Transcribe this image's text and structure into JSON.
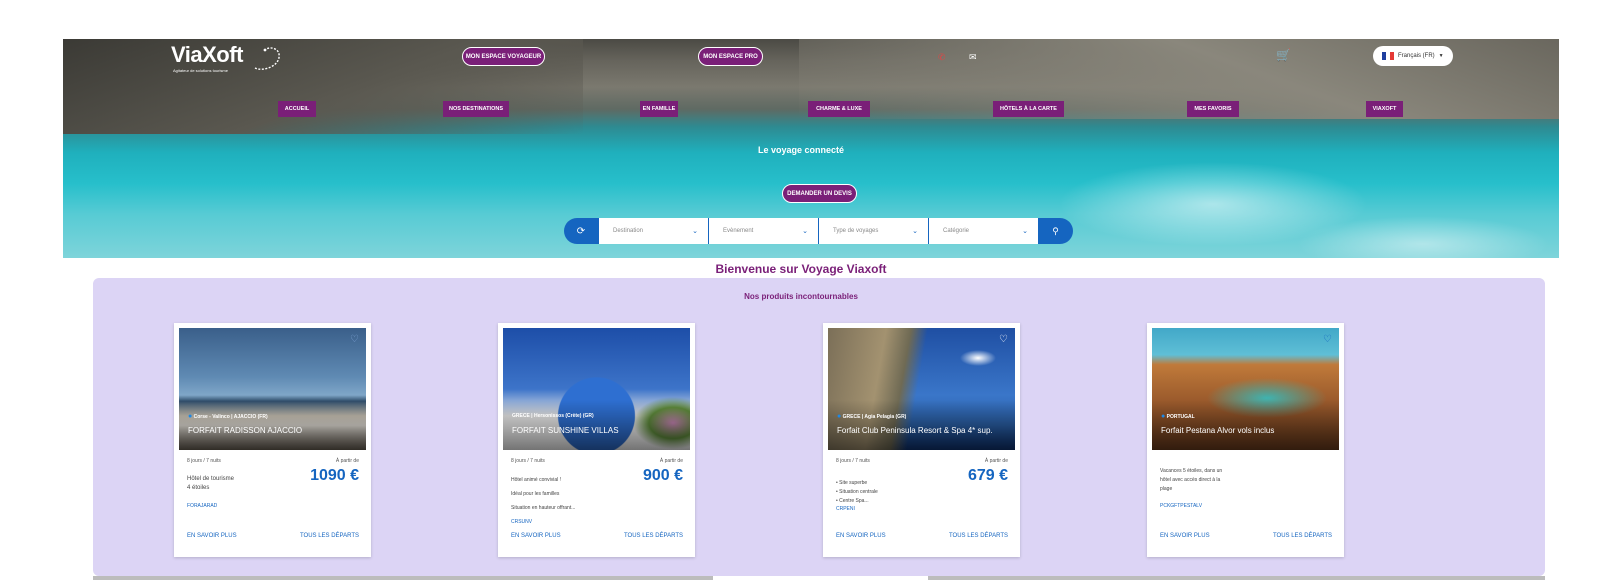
{
  "header": {
    "logo": {
      "name": "ViaXoft",
      "tagline": "Agitateur de solutions tourisme"
    },
    "buttons": {
      "voyageur": "MON ESPACE VOYAGEUR",
      "pro": "MON ESPACE PRO"
    },
    "language": {
      "label": "Français (FR)"
    },
    "icons": {
      "phone": "phone-icon",
      "mail": "mail-icon",
      "cart": "cart-icon"
    },
    "colors": {
      "accent": "#7a1f78",
      "primary": "#1565c0"
    }
  },
  "nav": {
    "items": [
      "ACCUEIL",
      "NOS DESTINATIONS",
      "EN FAMILLE",
      "CHARME & LUXE",
      "HÔTELS À LA CARTE",
      "MES FAVORIS",
      "VIAXOFT"
    ]
  },
  "hero": {
    "title": "Le voyage connecté",
    "cta": "DEMANDER UN DEVIS"
  },
  "search": {
    "fields": [
      {
        "placeholder": "Destination"
      },
      {
        "placeholder": "Evènement"
      },
      {
        "placeholder": "Type de voyages"
      },
      {
        "placeholder": "Catégorie"
      }
    ]
  },
  "main": {
    "welcome": "Bienvenue sur Voyage Viaxoft",
    "section_title": "Nos produits incontournables",
    "more_label": "EN SAVOIR PLUS",
    "departures_label": "TOUS LES DÉPARTS",
    "from_label": "À partir de"
  },
  "products": [
    {
      "location": "Corse - Valinco | AJACCIO (FR)",
      "name": "FORFAIT RADISSON AJACCIO",
      "duration": "8 jours / 7 nuits",
      "price": "1090 €",
      "description": [
        "Hôtel de tourisme",
        "4 étoiles"
      ],
      "code": "FORAJARAD"
    },
    {
      "location": "GRECE | Hersonissos (Crète) (GR)",
      "name": "FORFAIT SUNSHINE VILLAS",
      "duration": "8 jours / 7 nuits",
      "price": "900 €",
      "description": [
        "Hôtel animé convivial !",
        "Idéal pour les familles",
        "Situation en hauteur offrant..."
      ],
      "code": "CRSUNV"
    },
    {
      "location": "GRECE | Agia Pelagia (GR)",
      "name": "Forfait Club Peninsula Resort & Spa 4* sup.",
      "duration": "8 jours / 7 nuits",
      "price": "679 €",
      "description": [
        "• Site superbe",
        "• Situation centrale",
        "• Centre Spa..."
      ],
      "code": "CRPENI"
    },
    {
      "location": "PORTUGAL",
      "name": "Forfait Pestana Alvor vols inclus",
      "duration": "",
      "price": "",
      "description": [
        "Vacances 5 étoiles, dans un",
        "hôtel avec accès direct à la",
        "plage"
      ],
      "code": "PCKGFTPESTALV"
    }
  ]
}
